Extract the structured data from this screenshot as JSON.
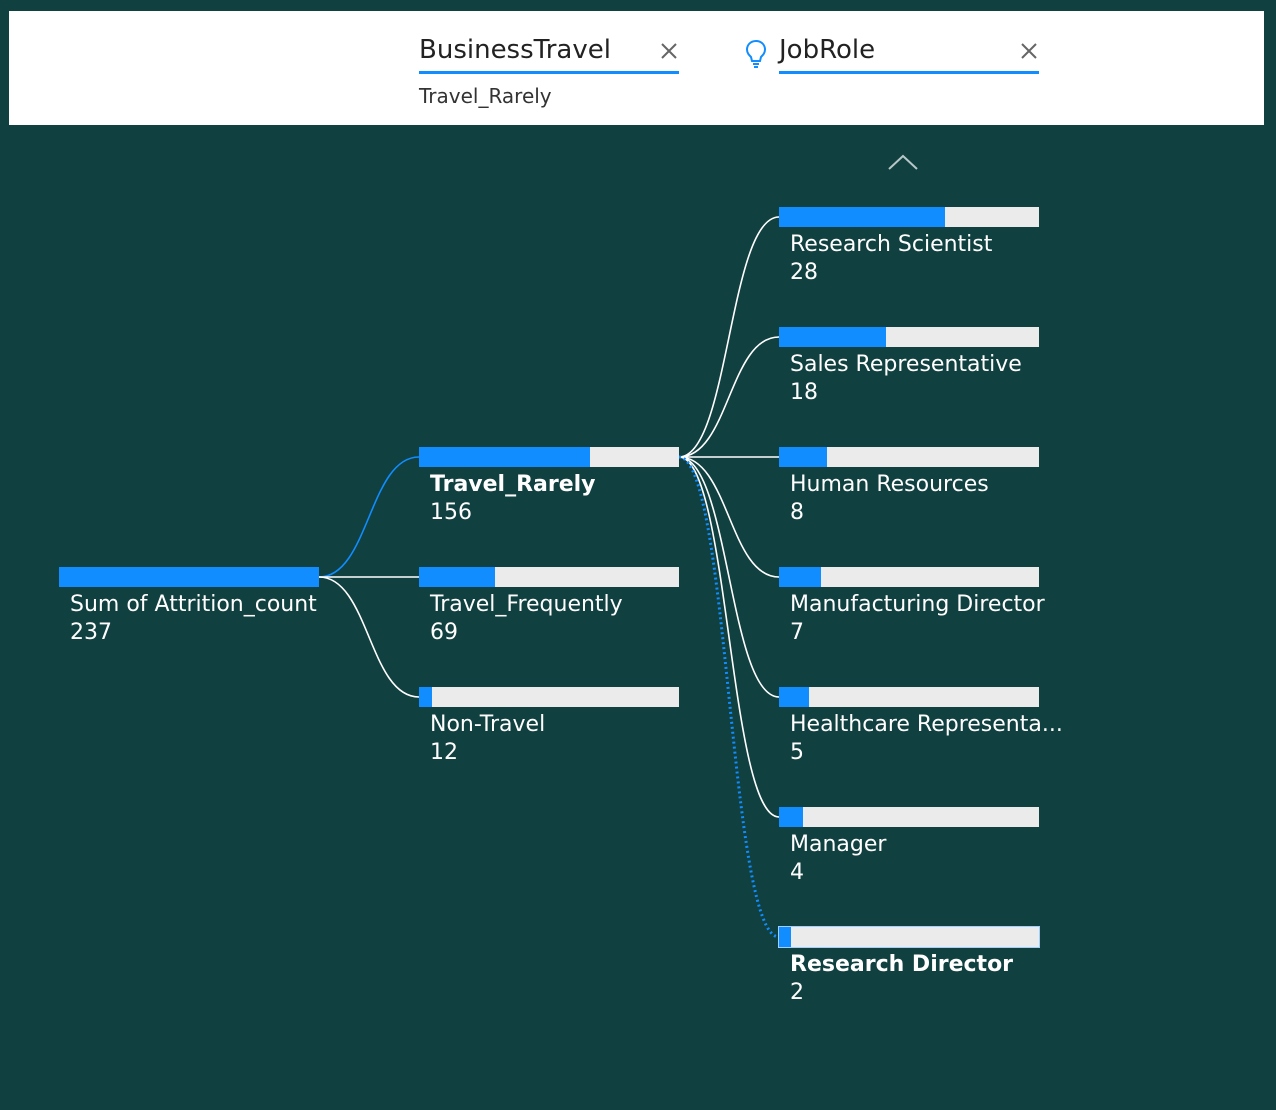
{
  "header": {
    "levels": [
      {
        "title": "BusinessTravel",
        "selected": "Travel_Rarely",
        "icon": "close-icon"
      },
      {
        "title": "JobRole",
        "selected": "",
        "icon": "close-icon",
        "prefix_icon": "lightbulb-icon"
      }
    ]
  },
  "colors": {
    "background": "#114040",
    "accent": "#118DFF",
    "track": "#EBEBEB",
    "header": "#ffffff"
  },
  "expand_icon": "chevron-up-icon",
  "chart_data": {
    "type": "decomposition-tree",
    "root": {
      "label": "Sum of Attrition_count",
      "value": "237",
      "amount": 237
    },
    "levels": [
      {
        "field": "BusinessTravel",
        "expanded_from": "Sum of Attrition_count",
        "nodes": [
          {
            "label": "Travel_Rarely",
            "value": "156",
            "amount": 156,
            "bold": true
          },
          {
            "label": "Travel_Frequently",
            "value": "69",
            "amount": 69
          },
          {
            "label": "Non-Travel",
            "value": "12",
            "amount": 12
          }
        ]
      },
      {
        "field": "JobRole",
        "expanded_from": "Travel_Rarely",
        "nodes": [
          {
            "label": "Research Scientist",
            "value": "28",
            "amount": 28
          },
          {
            "label": "Sales Representative",
            "value": "18",
            "amount": 18
          },
          {
            "label": "Human Resources",
            "value": "8",
            "amount": 8
          },
          {
            "label": "Manufacturing Director",
            "value": "7",
            "amount": 7
          },
          {
            "label": "Healthcare Representa...",
            "value": "5",
            "amount": 5
          },
          {
            "label": "Manager",
            "value": "4",
            "amount": 4
          },
          {
            "label": "Research Director",
            "value": "2",
            "amount": 2,
            "bold": true,
            "selected": true
          }
        ]
      }
    ]
  }
}
